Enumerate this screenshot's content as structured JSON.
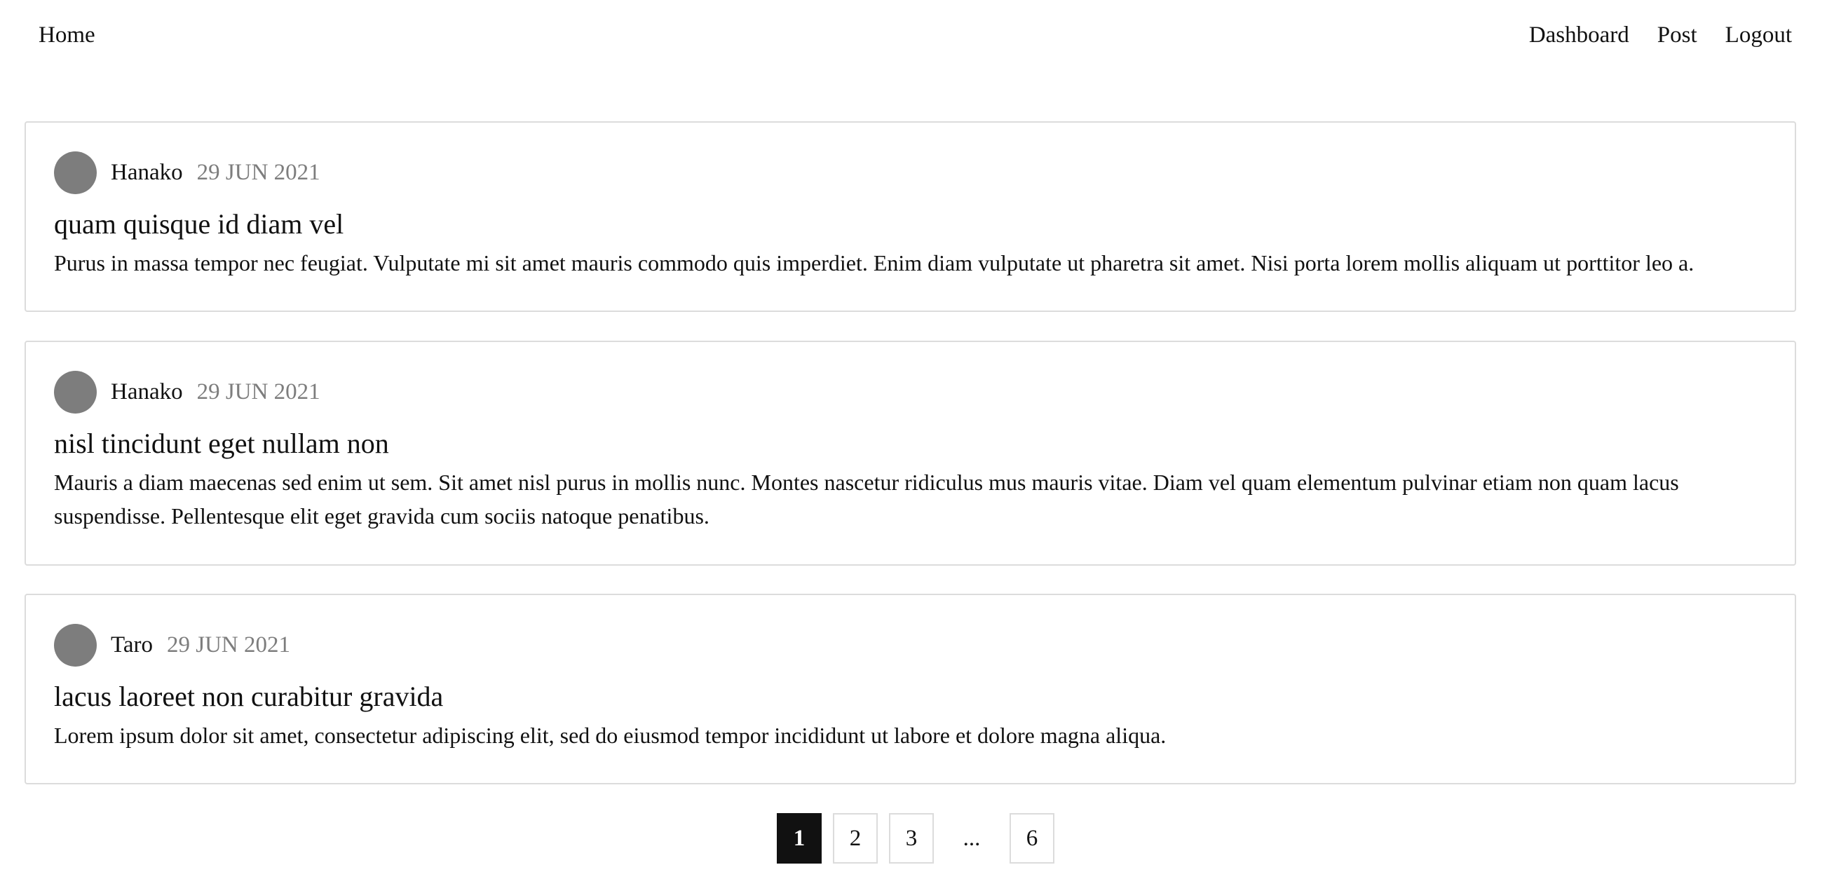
{
  "nav": {
    "home": "Home",
    "links": [
      "Dashboard",
      "Post",
      "Logout"
    ]
  },
  "posts": [
    {
      "author": "Hanako",
      "date": "29 JUN 2021",
      "title": "quam quisque id diam vel",
      "body": "Purus in massa tempor nec feugiat. Vulputate mi sit amet mauris commodo quis imperdiet. Enim diam vulputate ut pharetra sit amet. Nisi porta lorem mollis aliquam ut porttitor leo a."
    },
    {
      "author": "Hanako",
      "date": "29 JUN 2021",
      "title": "nisl tincidunt eget nullam non",
      "body": "Mauris a diam maecenas sed enim ut sem. Sit amet nisl purus in mollis nunc. Montes nascetur ridiculus mus mauris vitae. Diam vel quam elementum pulvinar etiam non quam lacus suspendisse. Pellentesque elit eget gravida cum sociis natoque penatibus."
    },
    {
      "author": "Taro",
      "date": "29 JUN 2021",
      "title": "lacus laoreet non curabitur gravida",
      "body": "Lorem ipsum dolor sit amet, consectetur adipiscing elit, sed do eiusmod tempor incididunt ut labore et dolore magna aliqua."
    }
  ],
  "pagination": {
    "pages": [
      "1",
      "2",
      "3"
    ],
    "ellipsis": "...",
    "last": "6",
    "current": "1"
  },
  "colors": {
    "text": "#111111",
    "muted": "#7d7d7d",
    "border": "#dcdcdc",
    "active_page_bg": "#111111"
  }
}
